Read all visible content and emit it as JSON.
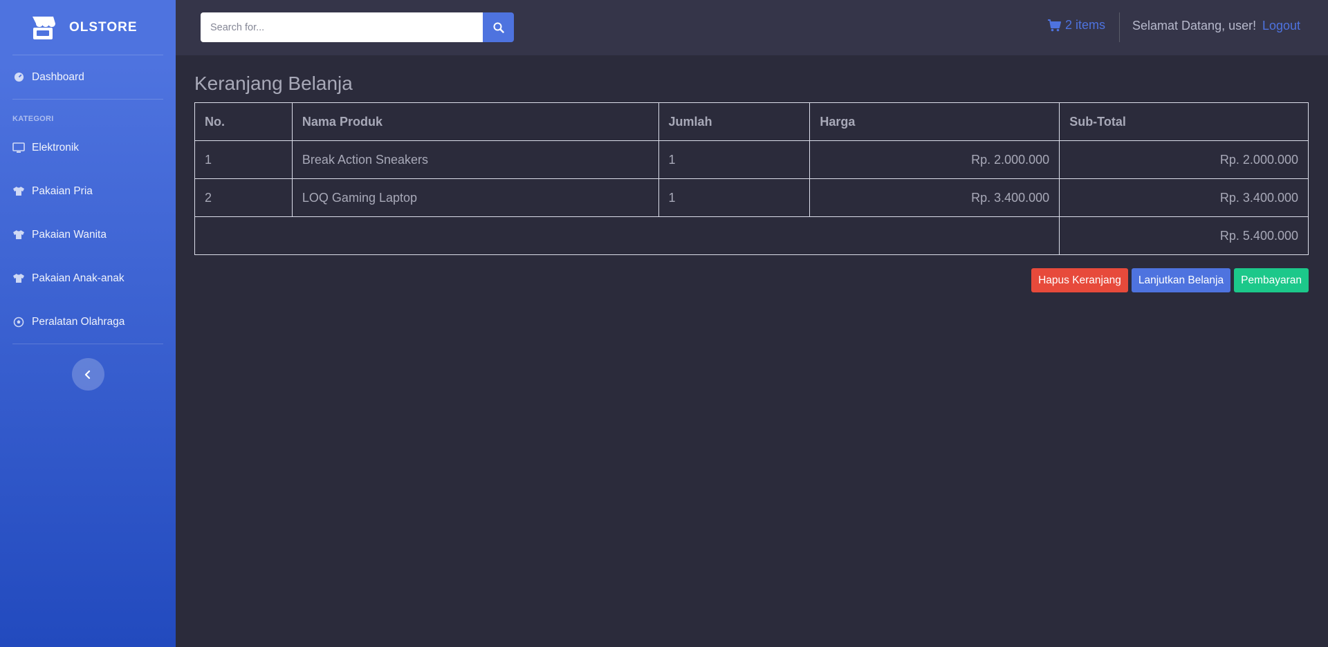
{
  "brand": {
    "name": "OLSTORE"
  },
  "sidebar": {
    "dashboard_label": "Dashboard",
    "heading": "KATEGORI",
    "items": [
      {
        "label": "Elektronik",
        "icon": "desktop-icon"
      },
      {
        "label": "Pakaian Pria",
        "icon": "shirt-icon"
      },
      {
        "label": "Pakaian Wanita",
        "icon": "shirt-icon"
      },
      {
        "label": "Pakaian Anak-anak",
        "icon": "shirt-icon"
      },
      {
        "label": "Peralatan Olahraga",
        "icon": "ball-icon"
      }
    ]
  },
  "topbar": {
    "search_placeholder": "Search for...",
    "cart_label": "2 items",
    "greeting": "Selamat Datang, user!",
    "logout_label": "Logout"
  },
  "page": {
    "title": "Keranjang Belanja"
  },
  "table": {
    "headers": [
      "No.",
      "Nama Produk",
      "Jumlah",
      "Harga",
      "Sub-Total"
    ],
    "rows": [
      {
        "no": "1",
        "name": "Break Action Sneakers",
        "qty": "1",
        "price": "Rp. 2.000.000",
        "subtotal": "Rp. 2.000.000"
      },
      {
        "no": "2",
        "name": "LOQ Gaming Laptop",
        "qty": "1",
        "price": "Rp. 3.400.000",
        "subtotal": "Rp. 3.400.000"
      }
    ],
    "total": "Rp. 5.400.000"
  },
  "actions": {
    "clear_label": "Hapus Keranjang",
    "continue_label": "Lanjutkan Belanja",
    "pay_label": "Pembayaran"
  },
  "colors": {
    "primary": "#4e73df",
    "danger": "#e74a3b",
    "success": "#1cc88a",
    "background": "#2b2b3b",
    "topbar": "#353549"
  }
}
